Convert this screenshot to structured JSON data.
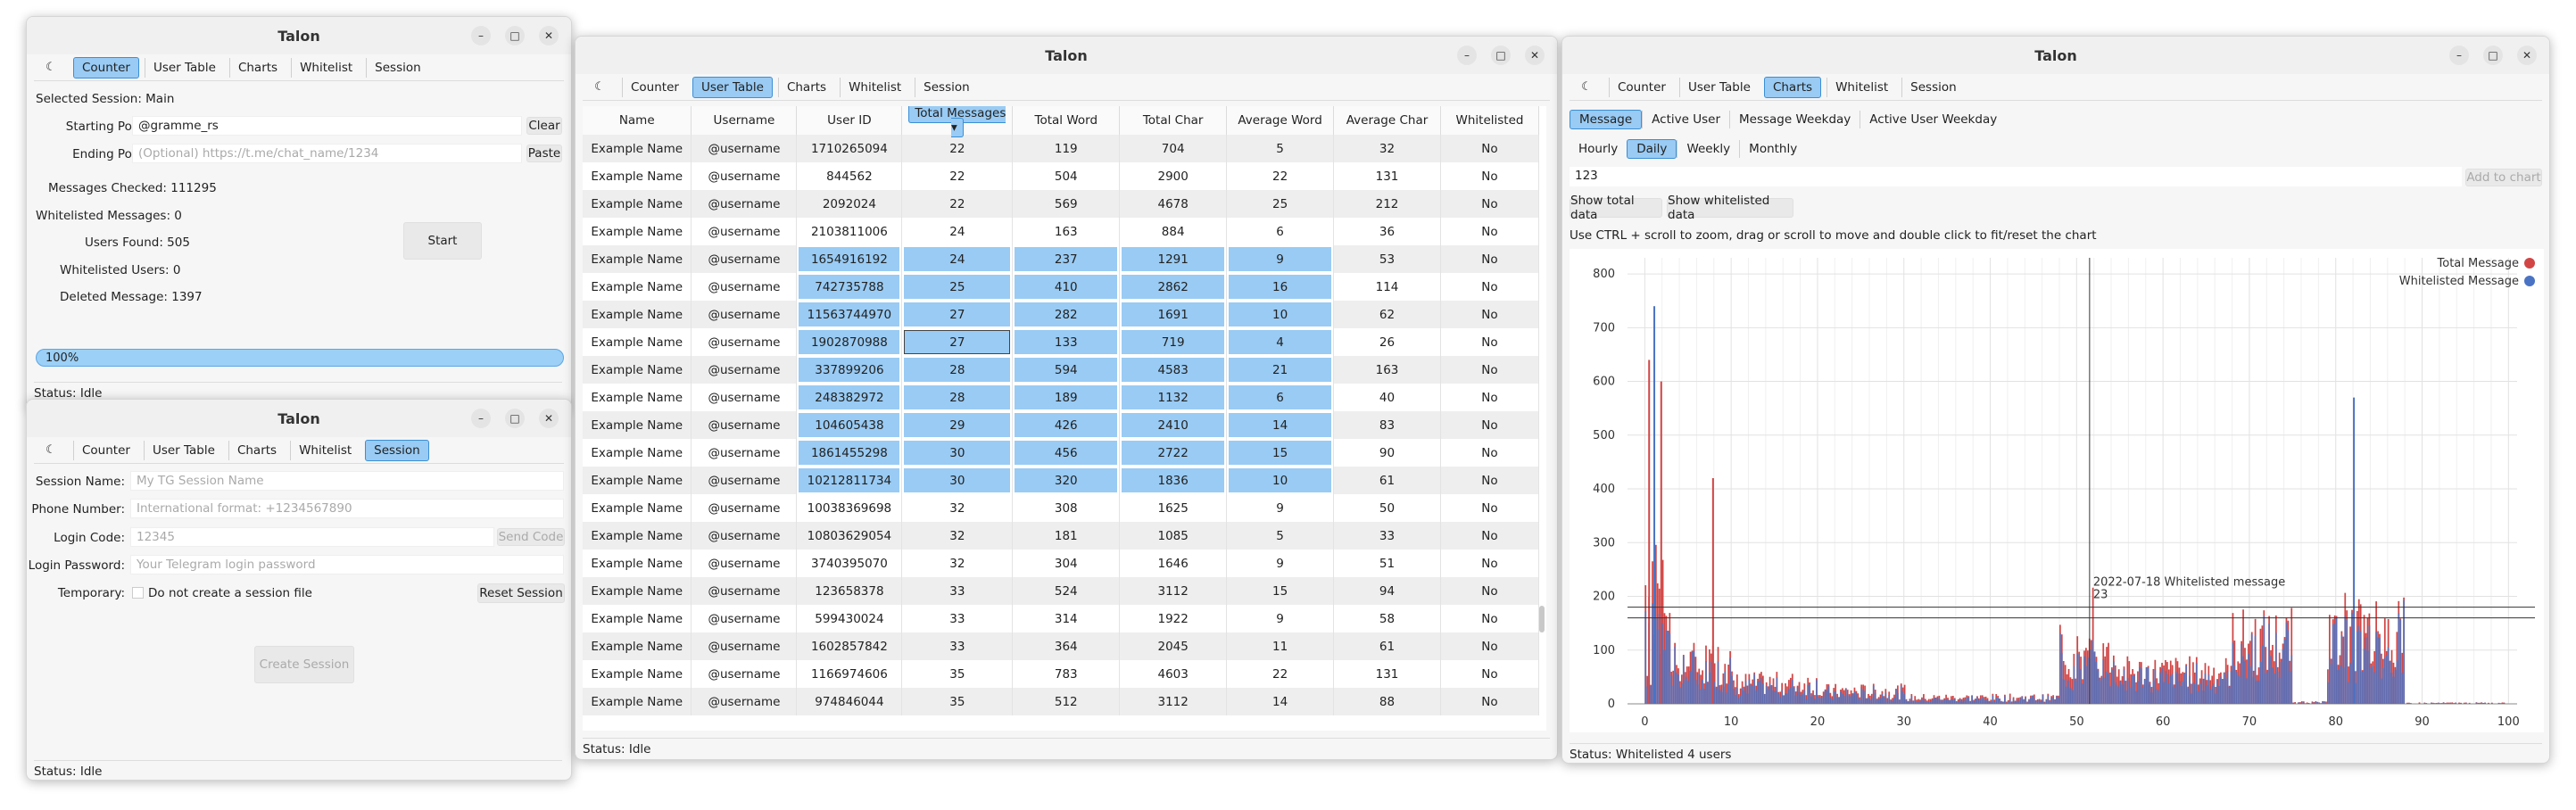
{
  "app_title": "Talon",
  "nav_tabs": [
    "Counter",
    "User Table",
    "Charts",
    "Whitelist",
    "Session"
  ],
  "win_controls": {
    "minimize": "–",
    "maximize": "□",
    "close": "✕"
  },
  "counter": {
    "selected_session": "Selected Session:  Main",
    "starting_label": "Starting Point:",
    "starting_value": "@gramme_rs",
    "clear_label": "Clear",
    "ending_label": "Ending Point:",
    "ending_placeholder": "(Optional) https://t.me/chat_name/1234",
    "paste_label": "Paste",
    "messages_checked": "Messages Checked:  111295",
    "whitelisted_messages": "Whitelisted Messages:  0",
    "users_found": "Users Found:  505",
    "whitelisted_users": "Whitelisted Users:  0",
    "deleted_message": "Deleted Message:  1397",
    "start_label": "Start",
    "progress_text": "100%",
    "progress": 1.0,
    "status": "Status: Idle"
  },
  "session": {
    "name_label": "Session Name:",
    "name_placeholder": "My TG Session Name",
    "phone_label": "Phone Number:",
    "phone_placeholder": "International format: +1234567890",
    "code_label": "Login Code:",
    "code_placeholder": "12345",
    "send_code": "Send Code",
    "password_label": "Login Password:",
    "password_placeholder": "Your Telegram login password",
    "temporary_label": "Temporary:",
    "temporary_checkbox": "Do not create a session file",
    "reset_label": "Reset Session",
    "create_label": "Create Session",
    "status": "Status: Idle"
  },
  "user_table": {
    "columns": [
      "Name",
      "Username",
      "User ID",
      "Total Messages ▾",
      "Total Word",
      "Total Char",
      "Average Word",
      "Average Char",
      "Whitelisted"
    ],
    "rows": [
      [
        "Example Name",
        "@username",
        "1710265094",
        "22",
        "119",
        "704",
        "5",
        "32",
        "No"
      ],
      [
        "Example Name",
        "@username",
        "844562",
        "22",
        "504",
        "2900",
        "22",
        "131",
        "No"
      ],
      [
        "Example Name",
        "@username",
        "2092024",
        "22",
        "569",
        "4678",
        "25",
        "212",
        "No"
      ],
      [
        "Example Name",
        "@username",
        "2103811006",
        "24",
        "163",
        "884",
        "6",
        "36",
        "No"
      ],
      [
        "Example Name",
        "@username",
        "1654916192",
        "24",
        "237",
        "1291",
        "9",
        "53",
        "No"
      ],
      [
        "Example Name",
        "@username",
        "742735788",
        "25",
        "410",
        "2862",
        "16",
        "114",
        "No"
      ],
      [
        "Example Name",
        "@username",
        "11563744970",
        "27",
        "282",
        "1691",
        "10",
        "62",
        "No"
      ],
      [
        "Example Name",
        "@username",
        "1902870988",
        "27",
        "133",
        "719",
        "4",
        "26",
        "No"
      ],
      [
        "Example Name",
        "@username",
        "337899206",
        "28",
        "594",
        "4583",
        "21",
        "163",
        "No"
      ],
      [
        "Example Name",
        "@username",
        "248382972",
        "28",
        "189",
        "1132",
        "6",
        "40",
        "No"
      ],
      [
        "Example Name",
        "@username",
        "104605438",
        "29",
        "426",
        "2410",
        "14",
        "83",
        "No"
      ],
      [
        "Example Name",
        "@username",
        "1861455298",
        "30",
        "456",
        "2722",
        "15",
        "90",
        "No"
      ],
      [
        "Example Name",
        "@username",
        "10212811734",
        "30",
        "320",
        "1836",
        "10",
        "61",
        "No"
      ],
      [
        "Example Name",
        "@username",
        "10038369698",
        "32",
        "308",
        "1625",
        "9",
        "50",
        "No"
      ],
      [
        "Example Name",
        "@username",
        "10803629054",
        "32",
        "181",
        "1085",
        "5",
        "33",
        "No"
      ],
      [
        "Example Name",
        "@username",
        "3740395070",
        "32",
        "304",
        "1646",
        "9",
        "51",
        "No"
      ],
      [
        "Example Name",
        "@username",
        "123658378",
        "33",
        "524",
        "3112",
        "15",
        "94",
        "No"
      ],
      [
        "Example Name",
        "@username",
        "599430024",
        "33",
        "314",
        "1922",
        "9",
        "58",
        "No"
      ],
      [
        "Example Name",
        "@username",
        "1602857842",
        "33",
        "364",
        "2045",
        "11",
        "61",
        "No"
      ],
      [
        "Example Name",
        "@username",
        "1166974606",
        "35",
        "783",
        "4603",
        "22",
        "131",
        "No"
      ],
      [
        "Example Name",
        "@username",
        "974846044",
        "35",
        "512",
        "3112",
        "14",
        "88",
        "No"
      ]
    ],
    "status": "Status: Idle"
  },
  "charts": {
    "subtabs": [
      "Message",
      "Active User",
      "Message Weekday",
      "Active User Weekday"
    ],
    "periods": [
      "Hourly",
      "Daily",
      "Weekly",
      "Monthly"
    ],
    "input_value": "123",
    "add_to_chart": "Add to chart",
    "show_total": "Show total data",
    "show_whitelisted": "Show whitelisted data",
    "hint": "Use CTRL + scroll to zoom, drag or scroll to move and double click to fit/reset the chart",
    "tooltip_line1": "2022-07-18 Whitelisted message",
    "tooltip_line2": "23",
    "status": "Status: Whitelisted 4 users",
    "colors": {
      "total": "#d24545",
      "whitelisted": "#4a73c4"
    }
  },
  "chart_data": {
    "type": "bar",
    "series": [
      {
        "name": "Total Message",
        "color": "#d24545"
      },
      {
        "name": "Whitelisted Message",
        "color": "#4a73c4"
      }
    ],
    "legend": "top-right",
    "xlim": [
      -2,
      101
    ],
    "ylim": [
      0,
      830
    ],
    "x_ticks": [
      0,
      10,
      20,
      30,
      40,
      50,
      60,
      70,
      80,
      90,
      100
    ],
    "y_ticks": [
      0,
      100,
      200,
      300,
      400,
      500,
      600,
      700,
      800
    ],
    "grid": true,
    "crosshair": {
      "x": 51.5,
      "y": 160
    }
  }
}
